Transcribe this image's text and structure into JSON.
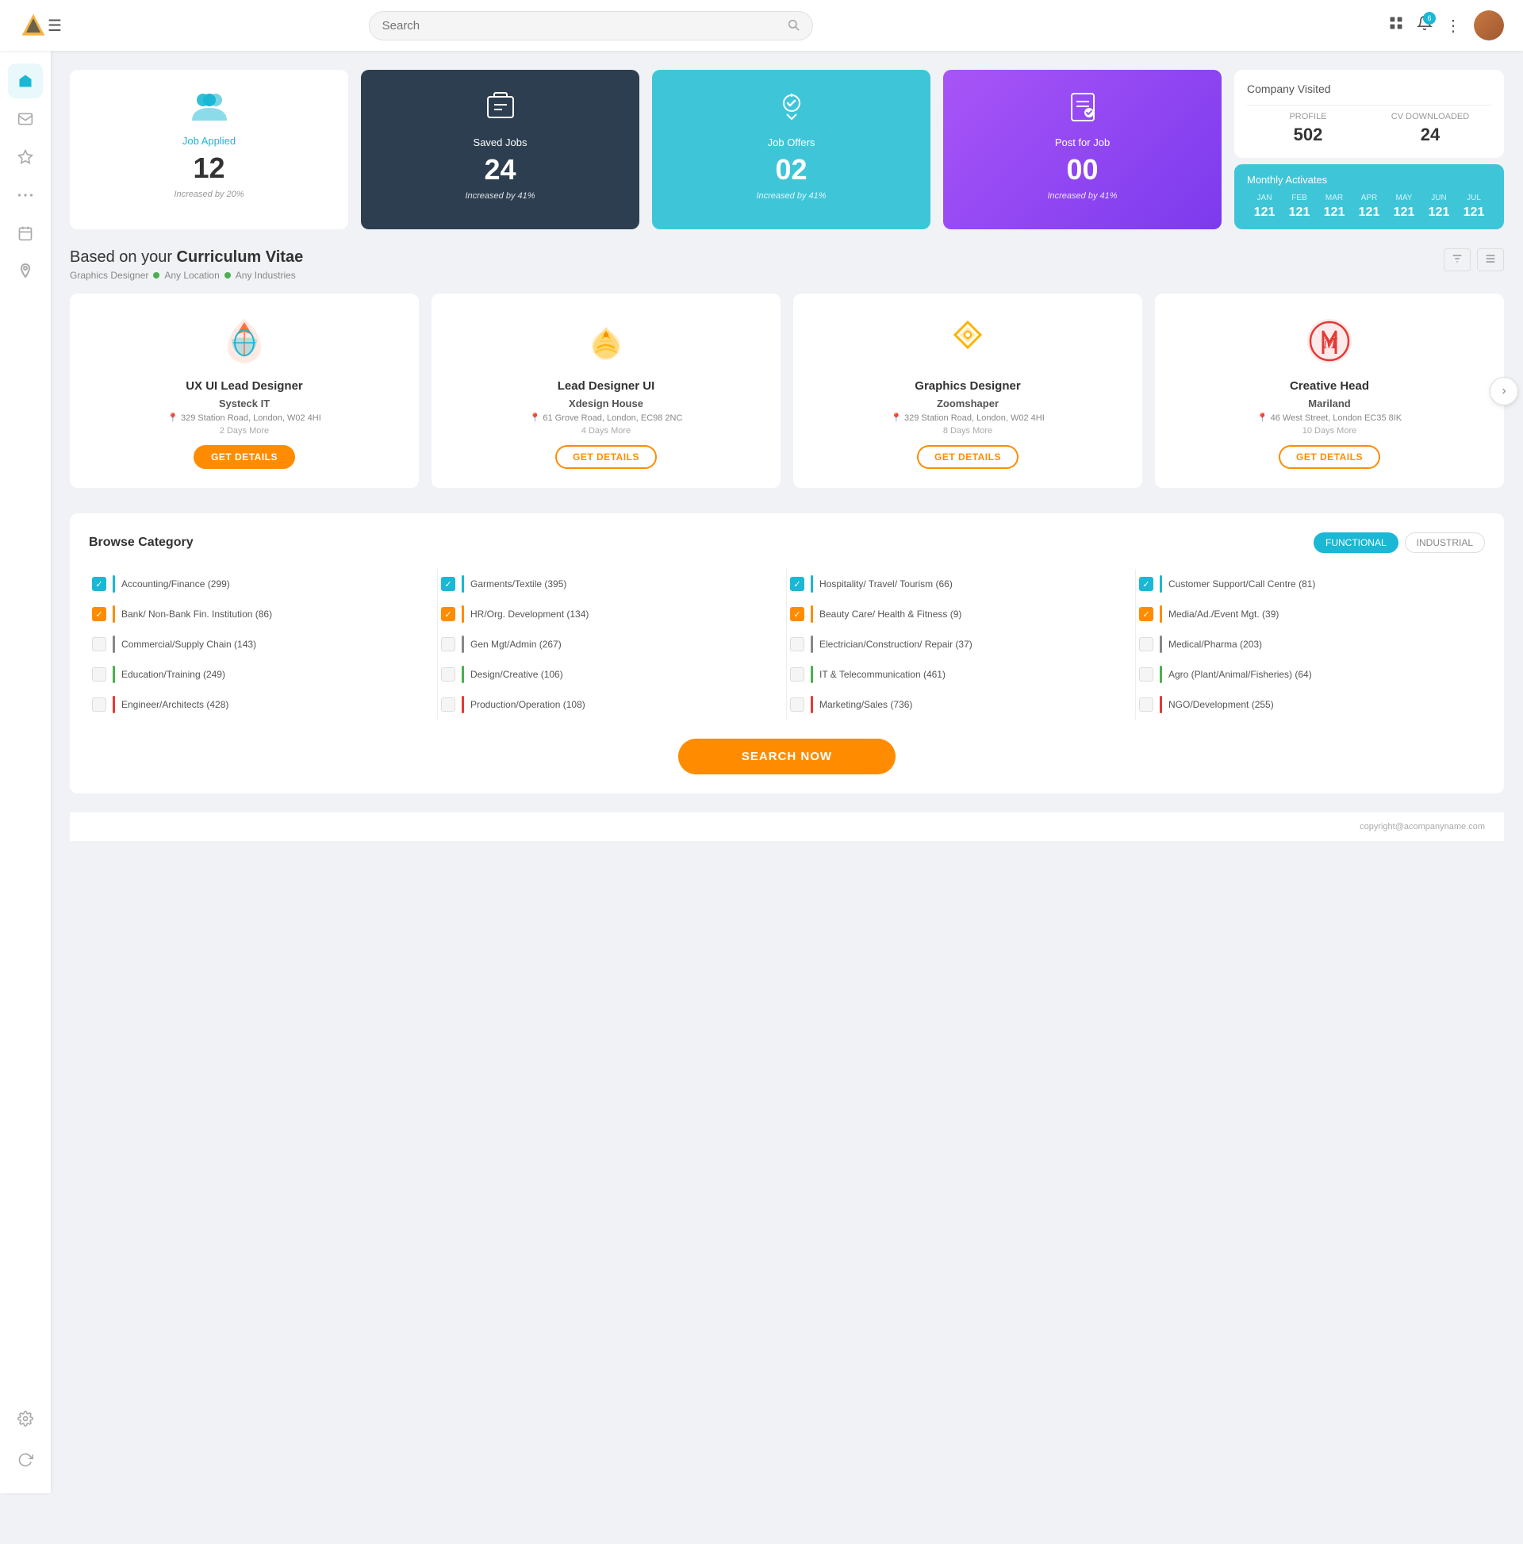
{
  "topnav": {
    "search_placeholder": "Search",
    "bell_badge": "6",
    "hamburger_label": "☰"
  },
  "sidebar": {
    "items": [
      {
        "id": "home",
        "icon": "⌂",
        "active": true
      },
      {
        "id": "mail",
        "icon": "✉"
      },
      {
        "id": "star",
        "icon": "☆"
      },
      {
        "id": "dots",
        "icon": "···"
      },
      {
        "id": "calendar",
        "icon": "📅"
      },
      {
        "id": "location",
        "icon": "📍"
      }
    ],
    "bottom_items": [
      {
        "id": "settings",
        "icon": "⚙"
      },
      {
        "id": "refresh",
        "icon": "↺"
      }
    ]
  },
  "stats": [
    {
      "id": "job-applied",
      "label": "Job Applied",
      "number": "12",
      "sub": "Increased by 20%",
      "icon": "👥",
      "style": "light",
      "color_label": "blue"
    },
    {
      "id": "saved-jobs",
      "label": "Saved Jobs",
      "number": "24",
      "sub": "Increased by 41%",
      "icon": "💼",
      "style": "dark"
    },
    {
      "id": "job-offers",
      "label": "Job Offers",
      "number": "02",
      "sub": "Increased by 41%",
      "icon": "💡",
      "style": "cyan"
    },
    {
      "id": "post-for-job",
      "label": "Post for Job",
      "number": "00",
      "sub": "Increased by 41%",
      "icon": "📋",
      "style": "purple"
    }
  ],
  "company": {
    "title": "Company Visited",
    "profile_label": "PROFILE",
    "profile_val": "502",
    "cv_label": "CV DOWNLOADED",
    "cv_val": "24"
  },
  "monthly": {
    "title": "Monthly Activates",
    "months": [
      {
        "label": "JAN",
        "val": "121"
      },
      {
        "label": "FEB",
        "val": "121"
      },
      {
        "label": "MAR",
        "val": "121"
      },
      {
        "label": "APR",
        "val": "121"
      },
      {
        "label": "MAY",
        "val": "121"
      },
      {
        "label": "JUN",
        "val": "121"
      },
      {
        "label": "JUL",
        "val": "121"
      }
    ]
  },
  "cv_section": {
    "title_normal": "Based on your ",
    "title_bold": "Curriculum Vitae",
    "filter_role": "Graphics Designer",
    "filter_location": "Any Location",
    "filter_industry": "Any Industries"
  },
  "jobs": [
    {
      "id": "job1",
      "title": "UX UI Lead Designer",
      "company": "Systeck IT",
      "address": "329 Station Road, London, W02 4HI",
      "days": "2 Days More",
      "btn": "GET DETAILS",
      "btn_filled": true
    },
    {
      "id": "job2",
      "title": "Lead Designer UI",
      "company": "Xdesign House",
      "address": "61 Grove Road, London, EC98 2NC",
      "days": "4 Days More",
      "btn": "GET DETAILS",
      "btn_filled": false
    },
    {
      "id": "job3",
      "title": "Graphics Designer",
      "company": "Zoomshaper",
      "address": "329 Station Road, London, W02 4HI",
      "days": "8 Days More",
      "btn": "GET DETAILS",
      "btn_filled": false
    },
    {
      "id": "job4",
      "title": "Creative Head",
      "company": "Mariland",
      "address": "46 West Street, London EC35 8IK",
      "days": "10 Days More",
      "btn": "GET DETAILS",
      "btn_filled": false
    }
  ],
  "browse": {
    "title": "Browse Category",
    "tabs": [
      "FUNCTIONAL",
      "INDUSTRIAL"
    ],
    "active_tab": "FUNCTIONAL",
    "categories": {
      "col1": [
        {
          "name": "Accounting/Finance (299)",
          "checked": true,
          "color": "#1ab8d4"
        },
        {
          "name": "Bank/ Non-Bank Fin. Institution (86)",
          "checked": true,
          "color": "#ff8c00"
        },
        {
          "name": "Commercial/Supply Chain (143)",
          "checked": false,
          "color": "#888"
        },
        {
          "name": "Education/Training (249)",
          "checked": false,
          "color": "#4caf50"
        },
        {
          "name": "Engineer/Architects (428)",
          "checked": false,
          "color": "#e53935"
        }
      ],
      "col2": [
        {
          "name": "Garments/Textile (395)",
          "checked": true,
          "color": "#1ab8d4"
        },
        {
          "name": "HR/Org. Development (134)",
          "checked": true,
          "color": "#ff8c00"
        },
        {
          "name": "Gen Mgt/Admin (267)",
          "checked": false,
          "color": "#888"
        },
        {
          "name": "Design/Creative (106)",
          "checked": false,
          "color": "#4caf50"
        },
        {
          "name": "Production/Operation (108)",
          "checked": false,
          "color": "#e53935"
        }
      ],
      "col3": [
        {
          "name": "Hospitality/ Travel/ Tourism (66)",
          "checked": true,
          "color": "#1ab8d4"
        },
        {
          "name": "Beauty Care/ Health & Fitness (9)",
          "checked": true,
          "color": "#ff8c00"
        },
        {
          "name": "Electrician/Construction/ Repair (37)",
          "checked": false,
          "color": "#888"
        },
        {
          "name": "IT & Telecommunication (461)",
          "checked": false,
          "color": "#4caf50"
        },
        {
          "name": "Marketing/Sales (736)",
          "checked": false,
          "color": "#e53935"
        }
      ],
      "col4": [
        {
          "name": "Customer Support/Call Centre (81)",
          "checked": true,
          "color": "#1ab8d4"
        },
        {
          "name": "Media/Ad./Event Mgt. (39)",
          "checked": true,
          "color": "#ff8c00"
        },
        {
          "name": "Medical/Pharma (203)",
          "checked": false,
          "color": "#888"
        },
        {
          "name": "Agro (Plant/Animal/Fisheries) (64)",
          "checked": false,
          "color": "#4caf50"
        },
        {
          "name": "NGO/Development (255)",
          "checked": false,
          "color": "#e53935"
        }
      ]
    }
  },
  "search_now_btn": "SEARCH NOW",
  "footer": "copyright@acompanyname.com"
}
